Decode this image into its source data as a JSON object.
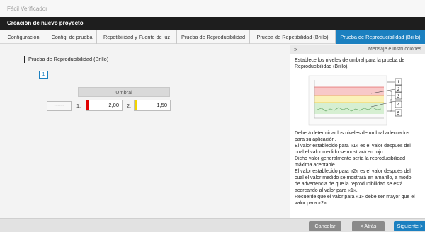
{
  "window": {
    "title": "Fácil Verificador"
  },
  "header": {
    "title": "Creación de nuevo proyecto"
  },
  "steps": [
    {
      "label": "Configuración"
    },
    {
      "label": "Config. de prueba"
    },
    {
      "label": "Repetibilidad y Fuente de luz"
    },
    {
      "label": "Prueba de Reproducibilidad"
    },
    {
      "label": "Prueba de Repetibilidad (Brillo)"
    },
    {
      "label": "Prueba de Reproducibilidad (Brillo)"
    }
  ],
  "main": {
    "section_title": "Prueba de Reproducibilidad (Brillo)",
    "index_box": "1",
    "umbral_label": "Umbral",
    "dash_button": "------",
    "threshold1": {
      "label": "1:",
      "value": "2,00",
      "color": "#e00000"
    },
    "threshold2": {
      "label": "2:",
      "value": "1,50",
      "color": "#f2d400"
    }
  },
  "panel": {
    "chevron": "»",
    "title": "Mensaje e instrucciones",
    "intro": [
      "Establece los niveles de umbral para la prueba de",
      "Reproducibilidad (Brillo)."
    ],
    "figure_labels": [
      "1",
      "2",
      "3",
      "4",
      "5"
    ],
    "body": [
      "Deberá determinar los niveles de umbral adecuados",
      "para su aplicación.",
      "El valor establecido para «1» es el valor después del",
      "cual el valor medido se mostrará en rojo.",
      "Dicho valor generalmente sería la reproducibilidad",
      "máxima aceptable.",
      "El valor establecido para «2» es el valor después del",
      "cual el valor medido se mostrará en amarillo, a modo",
      "de advertencia de que la reproducibilidad se está",
      "acercando al valor para «1».",
      "Recuerde que el valor para «1» debe ser mayor que el",
      "valor para «2»."
    ]
  },
  "footer": {
    "cancel": "Cancelar",
    "back": "< Atrás",
    "next": "Siguiente >"
  },
  "colors": {
    "accent": "#1b80c0",
    "header_bg": "#1e1e1e"
  }
}
